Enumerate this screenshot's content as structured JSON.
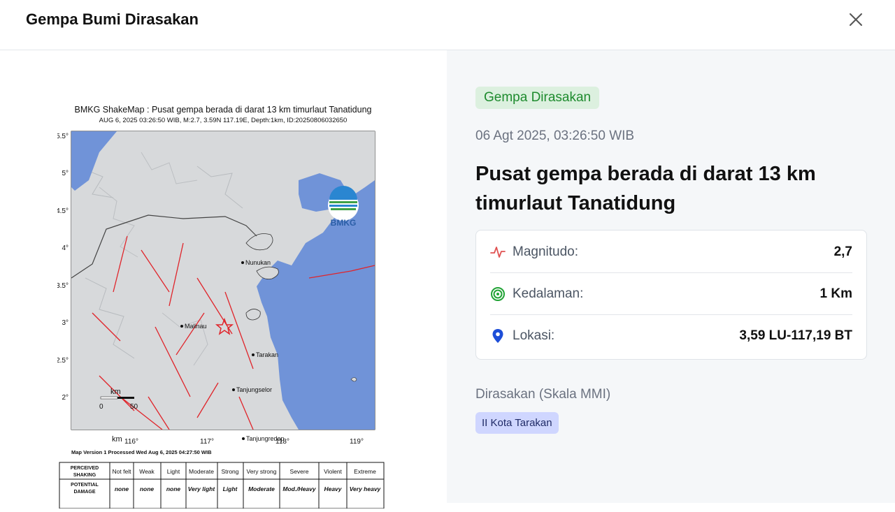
{
  "header": {
    "title": "Gempa Bumi Dirasakan",
    "close_icon": "close-icon"
  },
  "map": {
    "title": "BMKG ShakeMap : Pusat gempa berada di darat 13 km timurlaut Tanatidung",
    "subtitle": "AUG 6, 2025 03:26:50 WIB, M:2.7, 3.59N 117.19E, Depth:1km, ID:20250806032650",
    "logo_text": "BMKG",
    "y_ticks": [
      "5.5°",
      "5°",
      "4.5°",
      "4°",
      "3.5°",
      "3°",
      "2.5°",
      "2°"
    ],
    "x_ticks": [
      "116°",
      "117°",
      "118°",
      "119°"
    ],
    "cities": [
      "Nunukan",
      "Malinau",
      "Tarakan",
      "Tanjungselor",
      "Tanjungredep"
    ],
    "scale_label": "km",
    "scale_ticks": [
      "0",
      "50"
    ],
    "footer": "Map Version 1 Processed Wed Aug  6, 2025 04:27:50 WIB",
    "legend": {
      "row1_label_a": "PERCEIVED",
      "row1_label_b": "SHAKING",
      "row1": [
        "Not felt",
        "Weak",
        "Light",
        "Moderate",
        "Strong",
        "Very strong",
        "Severe",
        "Violent",
        "Extreme"
      ],
      "row2_label_a": "POTENTIAL",
      "row2_label_b": "DAMAGE",
      "row2": [
        "none",
        "none",
        "none",
        "Very light",
        "Light",
        "Moderate",
        "Mod./Heavy",
        "Heavy",
        "Very heavy"
      ]
    }
  },
  "event": {
    "badge": "Gempa Dirasakan",
    "time": "06 Agt 2025, 03:26:50 WIB",
    "title": "Pusat gempa berada di darat 13 km timurlaut Tanatidung"
  },
  "info": {
    "magnitude": {
      "icon": "activity-icon",
      "label": "Magnitudo:",
      "value": "2,7"
    },
    "depth": {
      "icon": "target-icon",
      "label": "Kedalaman:",
      "value": "1 Km"
    },
    "location": {
      "icon": "map-pin-icon",
      "label": "Lokasi:",
      "value": "3,59 LU-117,19 BT"
    }
  },
  "felt": {
    "heading": "Dirasakan (Skala MMI)",
    "items": [
      "II Kota Tarakan"
    ]
  },
  "colors": {
    "badge_green": "#1e8b2e",
    "sea_blue": "#7093d8",
    "fault_red": "#e0242a",
    "mmi_badge": "#cfd6ff"
  }
}
